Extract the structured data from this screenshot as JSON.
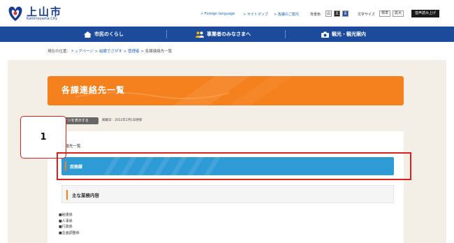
{
  "header": {
    "title": "上山市",
    "subtitle": "Kaminoyama City",
    "links": [
      "> Foreign language",
      "> サイトマップ",
      "> 各課のご案内"
    ],
    "color_label": "背景色",
    "colors": [
      "白",
      "黒",
      "青"
    ],
    "font_size_label": "文字サイズ",
    "font_sizes": [
      "標準",
      "拡大"
    ],
    "read_aloud": "音声読み上げ"
  },
  "nav": {
    "items": [
      {
        "label": "市民のくらし",
        "icon": "house-icon"
      },
      {
        "label": "事業者のみなさまへ",
        "icon": "people-icon"
      },
      {
        "label": "観光・観光案内",
        "icon": "camera-icon"
      }
    ]
  },
  "breadcrumb": {
    "prefix": "現在の位置：",
    "items": [
      "トップページ",
      "組織でさがす",
      "管理者",
      "各課連絡先一覧"
    ]
  },
  "page": {
    "title": "各課連絡先一覧",
    "read_page_button": "ページを表示する",
    "updated": "掲載日：2022年1月1日更新",
    "subtitle": "連絡先一覧",
    "department": "庶務課",
    "duties_heading": "主な業務内容",
    "duties": [
      "■秘書係",
      "■人事係",
      "■行政係",
      "■企画調整係"
    ]
  },
  "annotation": {
    "label": "1",
    "color": "#d82020"
  },
  "colors": {
    "nav": "#1d4b9c",
    "banner": "#f4801e",
    "department_bar": "#2e9ad6",
    "content_background": "#f4efe6"
  }
}
